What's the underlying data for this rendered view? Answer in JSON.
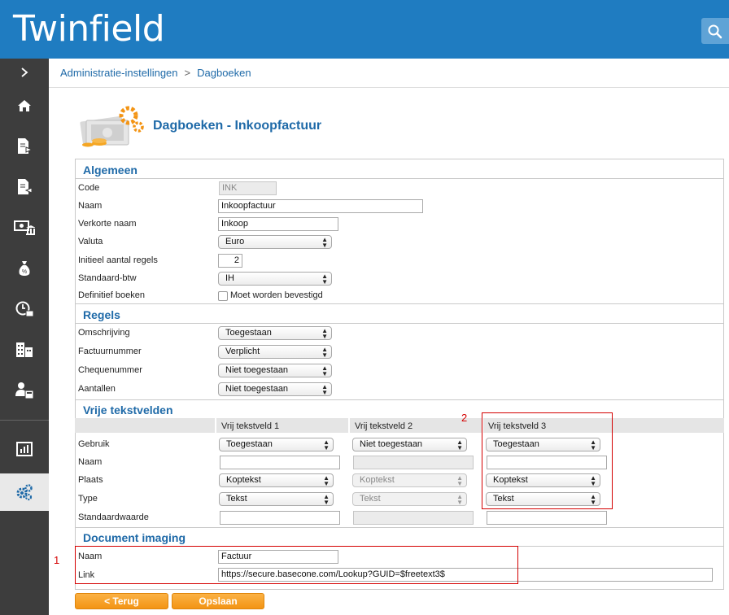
{
  "app": {
    "brand": "Twinfield"
  },
  "colors": {
    "topbar": "#1f7cc1",
    "sidebar": "#3d3d3d",
    "accent": "#1f6aa8",
    "button": "#f39414",
    "highlight": "#d40000"
  },
  "sidebar": {
    "toggle_icon": "chevron-right-icon",
    "items": [
      {
        "icon": "home-icon"
      },
      {
        "icon": "document-export-icon"
      },
      {
        "icon": "document-import-icon"
      },
      {
        "icon": "bank-icon"
      },
      {
        "icon": "money-bag-icon"
      },
      {
        "icon": "clock-briefcase-icon"
      },
      {
        "icon": "buildings-icon"
      },
      {
        "icon": "user-calculator-icon"
      },
      {
        "icon": "bar-chart-icon"
      },
      {
        "icon": "gears-icon",
        "active": true
      }
    ]
  },
  "breadcrumb": {
    "parent": "Administratie-instellingen",
    "separator": ">",
    "current": "Dagboeken"
  },
  "page": {
    "title": "Dagboeken - Inkoopfactuur"
  },
  "algemeen": {
    "title": "Algemeen",
    "code_label": "Code",
    "code_value": "INK",
    "naam_label": "Naam",
    "naam_value": "Inkoopfactuur",
    "verkorte_label": "Verkorte naam",
    "verkorte_value": "Inkoop",
    "valuta_label": "Valuta",
    "valuta_value": "Euro",
    "regels_label": "Initieel aantal regels",
    "regels_value": "2",
    "btw_label": "Standaard-btw",
    "btw_value": "IH",
    "definitief_label": "Definitief boeken",
    "definitief_checkbox_label": "Moet worden bevestigd"
  },
  "regels": {
    "title": "Regels",
    "omschrijving_label": "Omschrijving",
    "omschrijving_value": "Toegestaan",
    "factuurnummer_label": "Factuurnummer",
    "factuurnummer_value": "Verplicht",
    "chequenummer_label": "Chequenummer",
    "chequenummer_value": "Niet toegestaan",
    "aantallen_label": "Aantallen",
    "aantallen_value": "Niet toegestaan"
  },
  "vrije": {
    "title": "Vrije tekstvelden",
    "col1": "Vrij tekstveld 1",
    "col2": "Vrij tekstveld 2",
    "col3": "Vrij tekstveld 3",
    "gebruik_label": "Gebruik",
    "naam_label": "Naam",
    "plaats_label": "Plaats",
    "type_label": "Type",
    "standaard_label": "Standaardwaarde",
    "gebruik": [
      "Toegestaan",
      "Niet toegestaan",
      "Toegestaan"
    ],
    "plaats": [
      "Koptekst",
      "Koptekst",
      "Koptekst"
    ],
    "type": [
      "Tekst",
      "Tekst",
      "Tekst"
    ]
  },
  "imaging": {
    "title": "Document imaging",
    "naam_label": "Naam",
    "naam_value": "Factuur",
    "link_label": "Link",
    "link_value": "https://secure.basecone.com/Lookup?GUID=$freetext3$"
  },
  "annotations": {
    "marker_1": "1",
    "marker_2": "2"
  },
  "buttons": {
    "back": "< Terug",
    "save": "Opslaan"
  }
}
